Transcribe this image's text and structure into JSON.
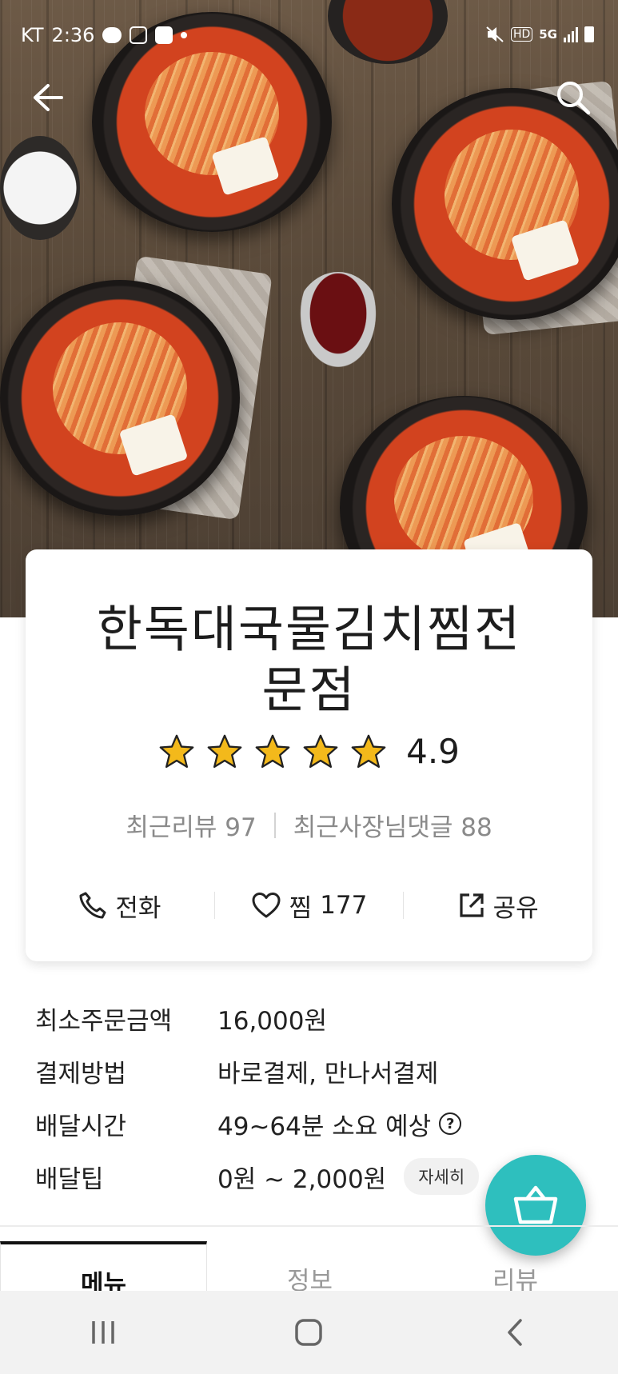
{
  "status_bar": {
    "carrier": "KT",
    "time": "2:36",
    "icons_left": [
      "kakaotalk-icon",
      "instagram-icon",
      "gallery-icon",
      "dot-icon"
    ],
    "icons_right": [
      "mute-icon",
      "hd-icon",
      "5g-icon",
      "signal-icon",
      "battery-icon"
    ],
    "hd_label": "HD",
    "network_label": "5G"
  },
  "header": {
    "back_icon": "arrow-left-icon",
    "search_icon": "search-icon"
  },
  "store": {
    "name": "한독대국물김치찜전문점",
    "rating": "4.9",
    "stars": 5,
    "recent_reviews_label": "최근리뷰",
    "recent_reviews_count": "97",
    "owner_replies_label": "최근사장님댓글",
    "owner_replies_count": "88"
  },
  "actions": {
    "call_label": "전화",
    "favorite_label": "찜",
    "favorite_count": "177",
    "share_label": "공유"
  },
  "info": {
    "min_order_key": "최소주문금액",
    "min_order_val": "16,000원",
    "payment_key": "결제방법",
    "payment_val": "바로결제, 만나서결제",
    "delivery_time_key": "배달시간",
    "delivery_time_val": "49~64분 소요 예상",
    "delivery_tip_key": "배달팁",
    "delivery_tip_val": "0원 ~ 2,000원",
    "detail_label": "자세히"
  },
  "tabs": [
    {
      "label": "메뉴",
      "active": true
    },
    {
      "label": "정보",
      "active": false
    },
    {
      "label": "리뷰",
      "active": false
    }
  ],
  "colors": {
    "accent": "#2ebfbe",
    "star": "#f3b91b",
    "text": "#222222",
    "muted": "#8a8a8a"
  }
}
